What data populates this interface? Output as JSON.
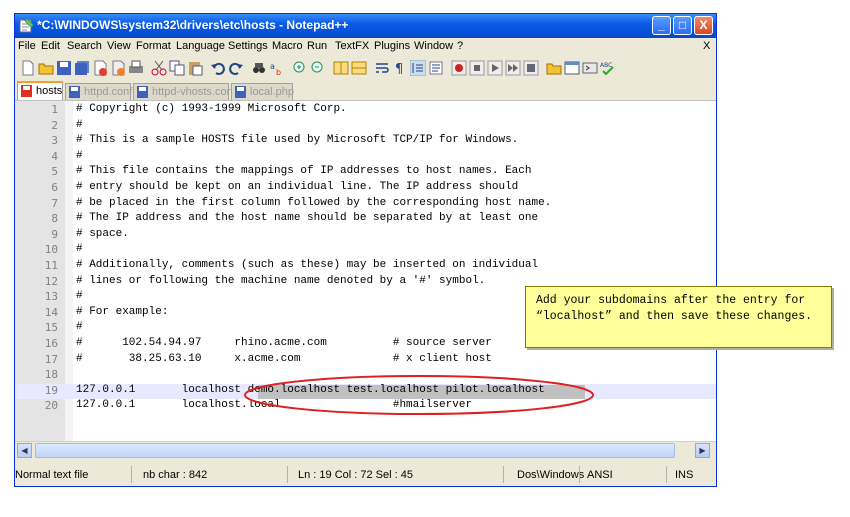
{
  "window": {
    "title": "*C:\\WINDOWS\\system32\\drivers\\etc\\hosts - Notepad++",
    "minimize": "_",
    "maximize": "□",
    "close": "X"
  },
  "menu": {
    "items": [
      "File",
      "Edit",
      "Search",
      "View",
      "Format",
      "Language",
      "Settings",
      "Macro",
      "Run",
      "TextFX",
      "Plugins",
      "Window",
      "?"
    ],
    "close_doc": "X"
  },
  "tabs": [
    {
      "label": "hosts",
      "active": true
    },
    {
      "label": "httpd.conf",
      "active": false
    },
    {
      "label": "httpd-vhosts.conf",
      "active": false
    },
    {
      "label": "local.php",
      "active": false
    }
  ],
  "editor": {
    "current_line": 19,
    "lines": [
      {
        "n": "1",
        "text": "# Copyright (c) 1993-1999 Microsoft Corp."
      },
      {
        "n": "2",
        "text": "#"
      },
      {
        "n": "3",
        "text": "# This is a sample HOSTS file used by Microsoft TCP/IP for Windows."
      },
      {
        "n": "4",
        "text": "#"
      },
      {
        "n": "5",
        "text": "# This file contains the mappings of IP addresses to host names. Each"
      },
      {
        "n": "6",
        "text": "# entry should be kept on an individual line. The IP address should"
      },
      {
        "n": "7",
        "text": "# be placed in the first column followed by the corresponding host name."
      },
      {
        "n": "8",
        "text": "# The IP address and the host name should be separated by at least one"
      },
      {
        "n": "9",
        "text": "# space."
      },
      {
        "n": "10",
        "text": "#"
      },
      {
        "n": "11",
        "text": "# Additionally, comments (such as these) may be inserted on individual"
      },
      {
        "n": "12",
        "text": "# lines or following the machine name denoted by a '#' symbol."
      },
      {
        "n": "13",
        "text": "#"
      },
      {
        "n": "14",
        "text": "# For example:"
      },
      {
        "n": "15",
        "text": "#"
      },
      {
        "n": "16",
        "text": "#      102.54.94.97     rhino.acme.com          # source server"
      },
      {
        "n": "17",
        "text": "#       38.25.63.10     x.acme.com              # x client host"
      },
      {
        "n": "18",
        "text": ""
      },
      {
        "n": "19",
        "text": "127.0.0.1       localhost demo.localhost test.localhost pilot.localhost"
      },
      {
        "n": "20",
        "text": "127.0.0.1       localhost.local                 #hmailserver"
      }
    ]
  },
  "statusbar": {
    "file_type": "Normal text file",
    "nb_char": "nb char : 842",
    "position": "Ln : 19   Col : 72   Sel : 45",
    "eol": "Dos\\Windows",
    "encoding": "ANSI",
    "mode": "INS"
  },
  "callout": {
    "text": "Add your subdomains after the entry for “localhost” and then save these changes."
  },
  "colors": {
    "titlebar": "#0a5ce6",
    "callout_bg": "#ffff99",
    "annotation_oval": "#e02020",
    "current_line": "#e8e8ff"
  }
}
